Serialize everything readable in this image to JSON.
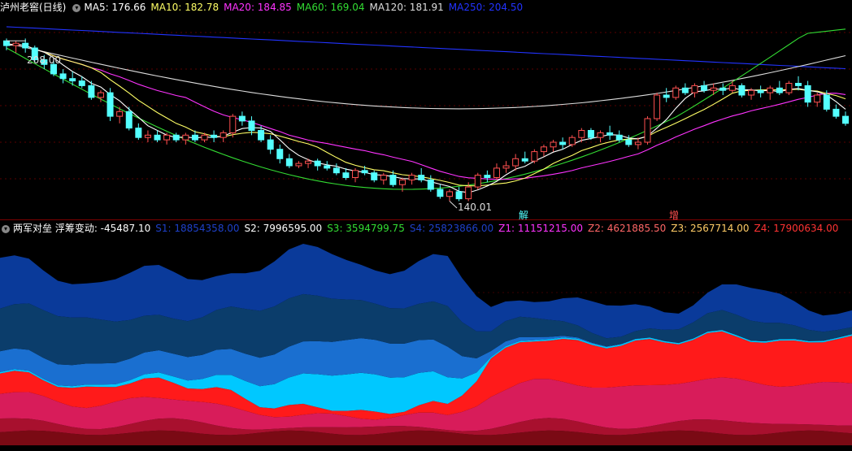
{
  "top_header": {
    "title": "泸州老窖(日线)",
    "ma5": "MA5: 176.66",
    "ma10": "MA10: 182.78",
    "ma20": "MA20: 184.85",
    "ma60": "MA60: 169.04",
    "ma120": "MA120: 181.91",
    "ma250": "MA250: 204.50"
  },
  "price_labels": {
    "high": "208.00",
    "low": "140.01"
  },
  "signals": {
    "jie": "解",
    "zeng": "增"
  },
  "bottom_header": {
    "title": "两军对垒 浮筹变动: -45487.10",
    "s1": "S1: 18854358.00",
    "s2": "S2: 7996595.00",
    "s3": "S3: 3594799.75",
    "s4": "S4: 25823866.00",
    "z1": "Z1: 11151215.00",
    "z2": "Z2: 4621885.50",
    "z3": "Z3: 2567714.00",
    "z4": "Z4: 17900634.00"
  },
  "colors": {
    "ma5": "#ffffff",
    "ma10": "#ffff66",
    "ma20": "#ff33ff",
    "ma60": "#33dd33",
    "ma120": "#dddddd",
    "ma250": "#2233ff",
    "up": "#ff5050",
    "down": "#54ffff",
    "s1": "#0a3a9a",
    "s2": "#0b3d6b",
    "s3": "#1a6fd0",
    "s4": "#00c8ff",
    "z1": "#ff1a1a",
    "z2": "#d81c5a",
    "z3": "#a8102e",
    "z4": "#7a0a14"
  },
  "chart_data": {
    "type": "candlestick",
    "price_range": [
      135,
      215
    ],
    "candles": [
      [
        208,
        209,
        204,
        206
      ],
      [
        206,
        208,
        203,
        207
      ],
      [
        207,
        209,
        203,
        205
      ],
      [
        205,
        206,
        199,
        200
      ],
      [
        200,
        202,
        196,
        198
      ],
      [
        198,
        200,
        193,
        194
      ],
      [
        194,
        196,
        190,
        192
      ],
      [
        192,
        195,
        189,
        191
      ],
      [
        191,
        193,
        188,
        189
      ],
      [
        189,
        191,
        183,
        184
      ],
      [
        184,
        187,
        182,
        186
      ],
      [
        186,
        188,
        174,
        176
      ],
      [
        176,
        180,
        173,
        178
      ],
      [
        178,
        180,
        170,
        171
      ],
      [
        171,
        173,
        166,
        167
      ],
      [
        167,
        170,
        165,
        168
      ],
      [
        168,
        170,
        165,
        166
      ],
      [
        166,
        169,
        164,
        168
      ],
      [
        168,
        169,
        165,
        166
      ],
      [
        166,
        169,
        164,
        168
      ],
      [
        168,
        170,
        165,
        166
      ],
      [
        166,
        169,
        165,
        168
      ],
      [
        168,
        170,
        165,
        167
      ],
      [
        167,
        170,
        165,
        169
      ],
      [
        169,
        177,
        167,
        176
      ],
      [
        176,
        178,
        172,
        174
      ],
      [
        174,
        176,
        168,
        170
      ],
      [
        170,
        172,
        165,
        166
      ],
      [
        166,
        168,
        160,
        162
      ],
      [
        162,
        164,
        156,
        158
      ],
      [
        158,
        160,
        154,
        155
      ],
      [
        155,
        157,
        154,
        156
      ],
      [
        156,
        158,
        154,
        157
      ],
      [
        157,
        158,
        153,
        155
      ],
      [
        155,
        157,
        153,
        154
      ],
      [
        154,
        156,
        151,
        152
      ],
      [
        152,
        154,
        149,
        150
      ],
      [
        150,
        154,
        148,
        153
      ],
      [
        153,
        155,
        151,
        152
      ],
      [
        152,
        153,
        148,
        149
      ],
      [
        149,
        152,
        147,
        151
      ],
      [
        151,
        153,
        146,
        147
      ],
      [
        147,
        150,
        144,
        149
      ],
      [
        149,
        152,
        147,
        151
      ],
      [
        151,
        154,
        148,
        149
      ],
      [
        149,
        151,
        144,
        145
      ],
      [
        145,
        147,
        141,
        142
      ],
      [
        142,
        145,
        140,
        144
      ],
      [
        144,
        146,
        140,
        141
      ],
      [
        141,
        148,
        140,
        146
      ],
      [
        146,
        152,
        145,
        151
      ],
      [
        151,
        153,
        148,
        150
      ],
      [
        150,
        156,
        149,
        154
      ],
      [
        154,
        157,
        152,
        155
      ],
      [
        155,
        160,
        153,
        158
      ],
      [
        158,
        161,
        156,
        157
      ],
      [
        157,
        162,
        156,
        161
      ],
      [
        161,
        164,
        159,
        163
      ],
      [
        163,
        166,
        161,
        165
      ],
      [
        165,
        167,
        162,
        164
      ],
      [
        164,
        168,
        163,
        167
      ],
      [
        167,
        171,
        165,
        170
      ],
      [
        170,
        171,
        166,
        167
      ],
      [
        167,
        170,
        165,
        169
      ],
      [
        169,
        172,
        166,
        168
      ],
      [
        168,
        170,
        165,
        166
      ],
      [
        166,
        168,
        163,
        164
      ],
      [
        164,
        167,
        162,
        165
      ],
      [
        165,
        176,
        164,
        175
      ],
      [
        175,
        186,
        174,
        185
      ],
      [
        185,
        188,
        182,
        184
      ],
      [
        184,
        189,
        183,
        188
      ],
      [
        188,
        190,
        185,
        186
      ],
      [
        186,
        190,
        184,
        189
      ],
      [
        189,
        191,
        186,
        187
      ],
      [
        187,
        190,
        185,
        188
      ],
      [
        188,
        190,
        185,
        187
      ],
      [
        187,
        191,
        186,
        189
      ],
      [
        189,
        190,
        184,
        185
      ],
      [
        185,
        188,
        183,
        187
      ],
      [
        187,
        189,
        184,
        186
      ],
      [
        186,
        189,
        183,
        188
      ],
      [
        188,
        191,
        185,
        186
      ],
      [
        186,
        191,
        185,
        190
      ],
      [
        190,
        193,
        187,
        189
      ],
      [
        189,
        191,
        180,
        182
      ],
      [
        182,
        186,
        180,
        185
      ],
      [
        185,
        187,
        178,
        179
      ],
      [
        179,
        181,
        175,
        176
      ],
      [
        176,
        178,
        172,
        173
      ]
    ],
    "stack_order": [
      "z4",
      "z3",
      "z2",
      "z1",
      "s4",
      "s3",
      "s2",
      "s1"
    ]
  }
}
